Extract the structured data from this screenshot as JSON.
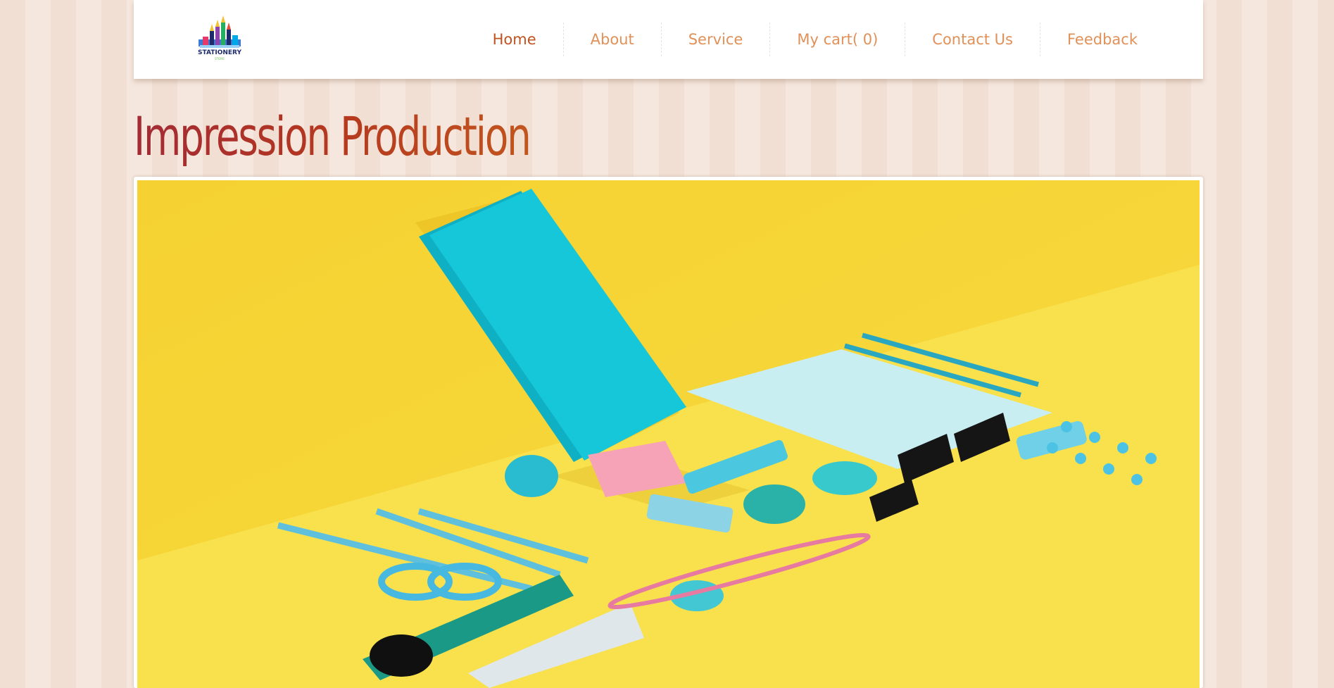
{
  "brand": {
    "logo_text": "STATIONERY",
    "logo_sub": "STORE"
  },
  "nav": {
    "items": [
      {
        "label": "Home",
        "active": true
      },
      {
        "label": "About",
        "active": false
      },
      {
        "label": "Service",
        "active": false
      },
      {
        "label": "My cart( 0)",
        "active": false
      },
      {
        "label": "Contact Us",
        "active": false
      },
      {
        "label": "Feedback",
        "active": false
      }
    ]
  },
  "page": {
    "title": "Impression Production"
  },
  "colors": {
    "nav_text": "#e0915a",
    "nav_active": "#c0531f",
    "title_start": "#a32a35",
    "title_end": "#c2551e",
    "banner_bg": "#f8d93e",
    "accent_teal": "#15c3d6"
  },
  "banner": {
    "icon": "stationery-flatlay-image"
  }
}
